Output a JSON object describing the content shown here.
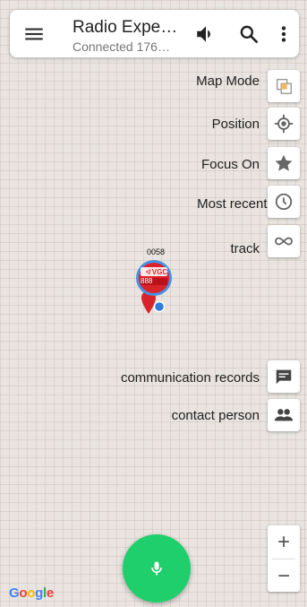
{
  "header": {
    "title": "Radio Expe…",
    "subtitle": "Connected 176…",
    "icons": [
      "menu-icon",
      "volume-icon",
      "search-icon",
      "more-vert-icon"
    ]
  },
  "map_controls": [
    {
      "label": "Map Mode",
      "icon": "layers-icon"
    },
    {
      "label": "Position",
      "icon": "my-location-icon"
    },
    {
      "label": "Focus On",
      "icon": "star-icon"
    },
    {
      "label": "Most recent time",
      "icon": "clock-icon"
    },
    {
      "label": "track",
      "icon": "infinity-icon"
    }
  ],
  "side_actions": [
    {
      "label": "communication records",
      "icon": "chat-icon"
    },
    {
      "label": "contact person",
      "icon": "people-icon"
    }
  ],
  "marker": {
    "id": "0058",
    "badge_number": "888",
    "badge_text": "≮ VGC"
  },
  "zoom": {
    "in": "+",
    "out": "−"
  },
  "fab": {
    "icon": "microphone-icon",
    "color": "#1fcf6c"
  },
  "watermark": {
    "text": "Google"
  }
}
